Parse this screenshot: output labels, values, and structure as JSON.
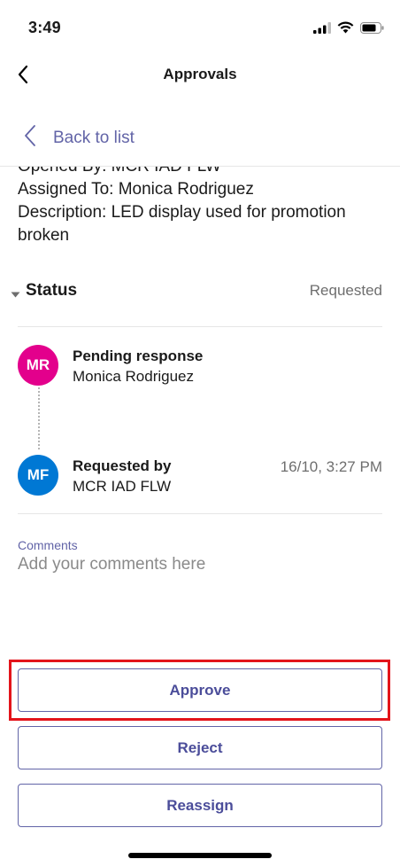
{
  "status_bar": {
    "time": "3:49",
    "icons": [
      "cellular-signal-icon",
      "wifi-icon",
      "battery-icon"
    ]
  },
  "header": {
    "back_icon": "chevron-left-icon",
    "title": "Approvals"
  },
  "back_to_list": {
    "icon": "chevron-left-icon",
    "label": "Back to list"
  },
  "details": {
    "cut_off_line": "Opened By: MCR IAD FLW",
    "assigned_to": "Assigned To: Monica Rodriguez",
    "description_line1": "Description: LED display used for promotion",
    "description_line2": "broken"
  },
  "status": {
    "caret_icon": "caret-down-icon",
    "title": "Status",
    "value": "Requested"
  },
  "approvers": [
    {
      "initials": "MR",
      "role": "Pending response",
      "name": "Monica Rodriguez",
      "time": "",
      "avatar_color": "#e3008c"
    },
    {
      "initials": "MF",
      "role": "Requested by",
      "name": "MCR IAD FLW",
      "time": "16/10, 3:27 PM",
      "avatar_color": "#0078d4"
    }
  ],
  "comments": {
    "label": "Comments",
    "placeholder": "Add your comments here",
    "value": ""
  },
  "actions": {
    "approve": "Approve",
    "reject": "Reject",
    "reassign": "Reassign"
  },
  "colors": {
    "accent": "#6264a7",
    "highlight": "#e3141b"
  }
}
